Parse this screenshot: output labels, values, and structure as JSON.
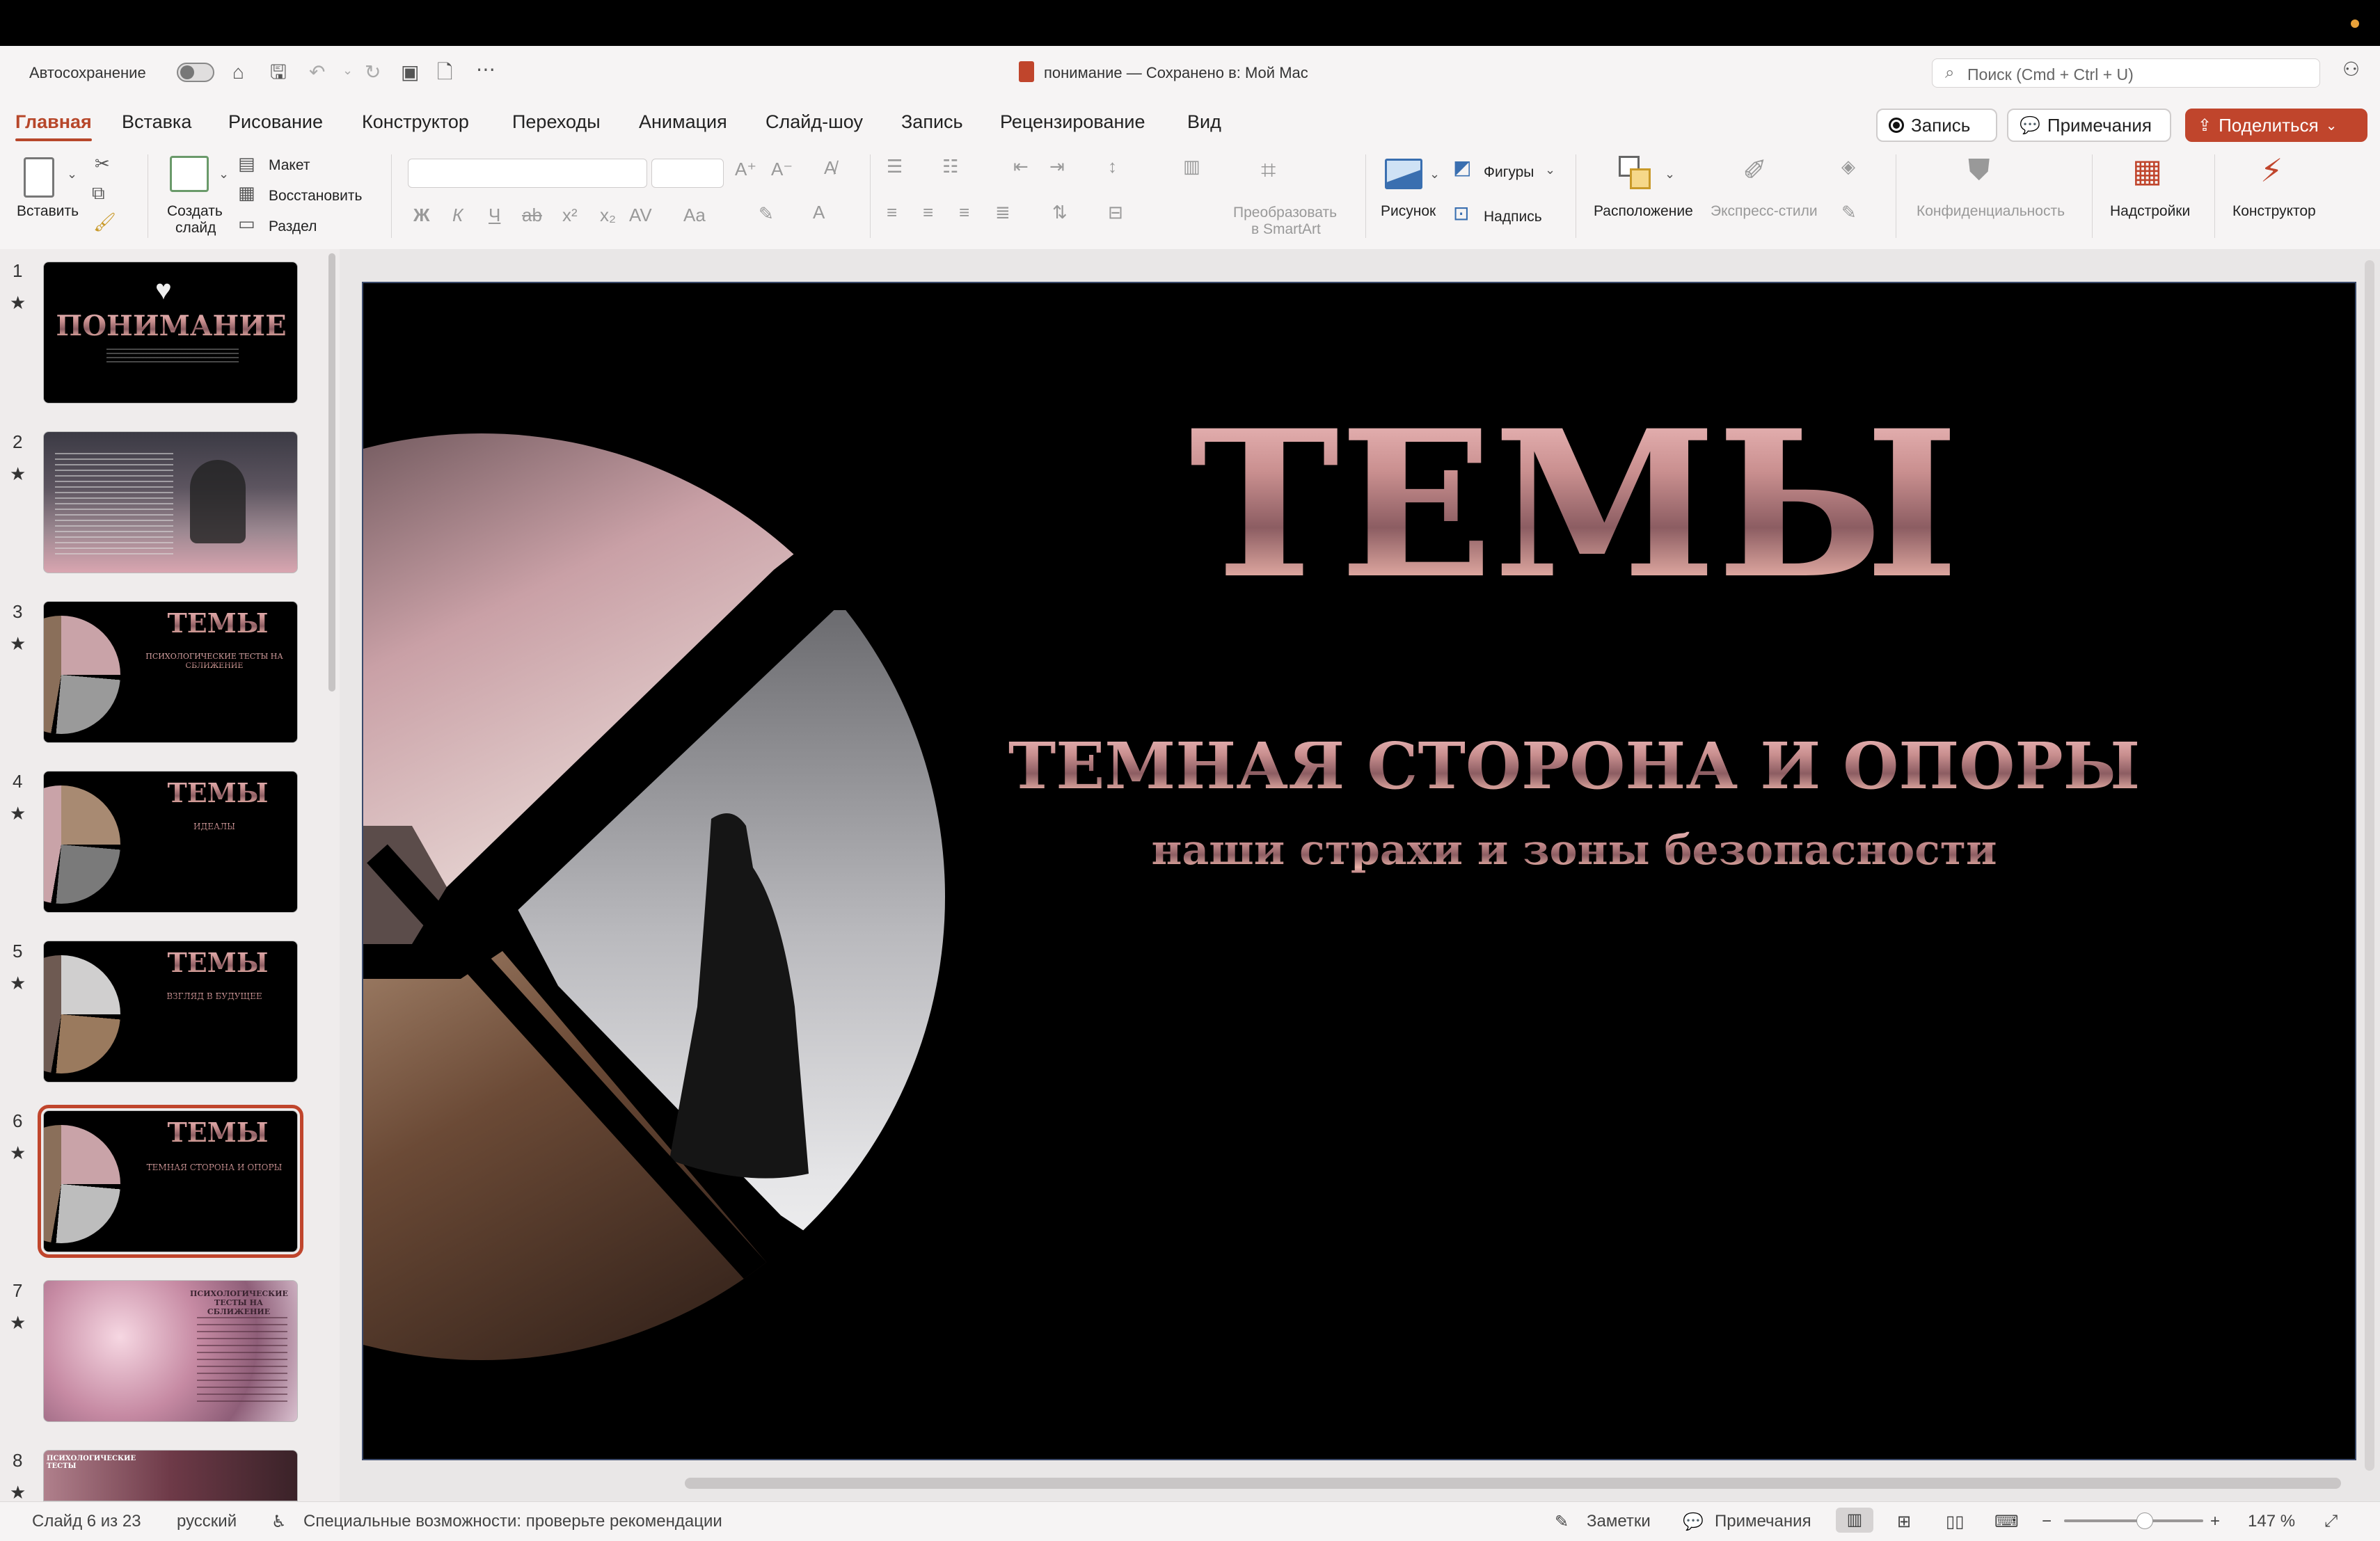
{
  "titlebar": {
    "autosave_label": "Автосохранение",
    "document_title": "понимание — Сохранено в: Мой Mac",
    "search_placeholder": "Поиск (Cmd + Ctrl + U)"
  },
  "tabs": [
    "Главная",
    "Вставка",
    "Рисование",
    "Конструктор",
    "Переходы",
    "Анимация",
    "Слайд-шоу",
    "Запись",
    "Рецензирование",
    "Вид"
  ],
  "active_tab": "Главная",
  "header_buttons": {
    "record": "Запись",
    "comments": "Примечания",
    "share": "Поделиться"
  },
  "ribbon": {
    "paste": "Вставить",
    "new_slide": [
      "Создать",
      "слайд"
    ],
    "layout": "Макет",
    "reset": "Восстановить",
    "section": "Раздел",
    "font_buttons": [
      "Ж",
      "К",
      "Ч",
      "ab",
      "x²",
      "x₂",
      "AV",
      "Aa"
    ],
    "smartart": [
      "Преобразовать",
      "в SmartArt"
    ],
    "picture": "Рисунок",
    "shapes": "Фигуры",
    "textbox": "Надпись",
    "arrange": "Расположение",
    "quick_styles": "Экспресс-стили",
    "sensitivity": "Конфиденциальность",
    "addins": "Надстройки",
    "designer": "Конструктор"
  },
  "thumbnails": [
    {
      "num": "1",
      "title": "ПОНИМАНИЕ"
    },
    {
      "num": "2",
      "title": ""
    },
    {
      "num": "3",
      "title": "ТЕМЫ",
      "subtitle": "ПСИХОЛОГИЧЕСКИЕ ТЕСТЫ НА СБЛИЖЕНИЕ"
    },
    {
      "num": "4",
      "title": "ТЕМЫ",
      "subtitle": "ИДЕАЛЫ"
    },
    {
      "num": "5",
      "title": "ТЕМЫ",
      "subtitle": "ВЗГЛЯД В БУДУЩЕЕ"
    },
    {
      "num": "6",
      "title": "ТЕМЫ",
      "subtitle": "ТЕМНАЯ СТОРОНА И ОПОРЫ"
    },
    {
      "num": "7",
      "title": "ПСИХОЛОГИЧЕСКИЕ ТЕСТЫ НА СБЛИЖЕНИЕ"
    },
    {
      "num": "8",
      "title": "ПСИХОЛОГИЧЕСКИЕ ТЕСТЫ"
    }
  ],
  "selected_slide": 6,
  "slide": {
    "title": "ТЕМЫ",
    "subtitle": "ТЕМНАЯ СТОРОНА И ОПОРЫ",
    "caption": "наши страхи и зоны безопасности"
  },
  "status": {
    "slide_count": "Слайд 6 из 23",
    "language": "русский",
    "accessibility": "Специальные возможности: проверьте рекомендации",
    "notes": "Заметки",
    "comments": "Примечания",
    "zoom": "147 %"
  },
  "colors": {
    "accent": "#b7472a",
    "share": "#c0452c",
    "slide_bg": "#000000"
  }
}
